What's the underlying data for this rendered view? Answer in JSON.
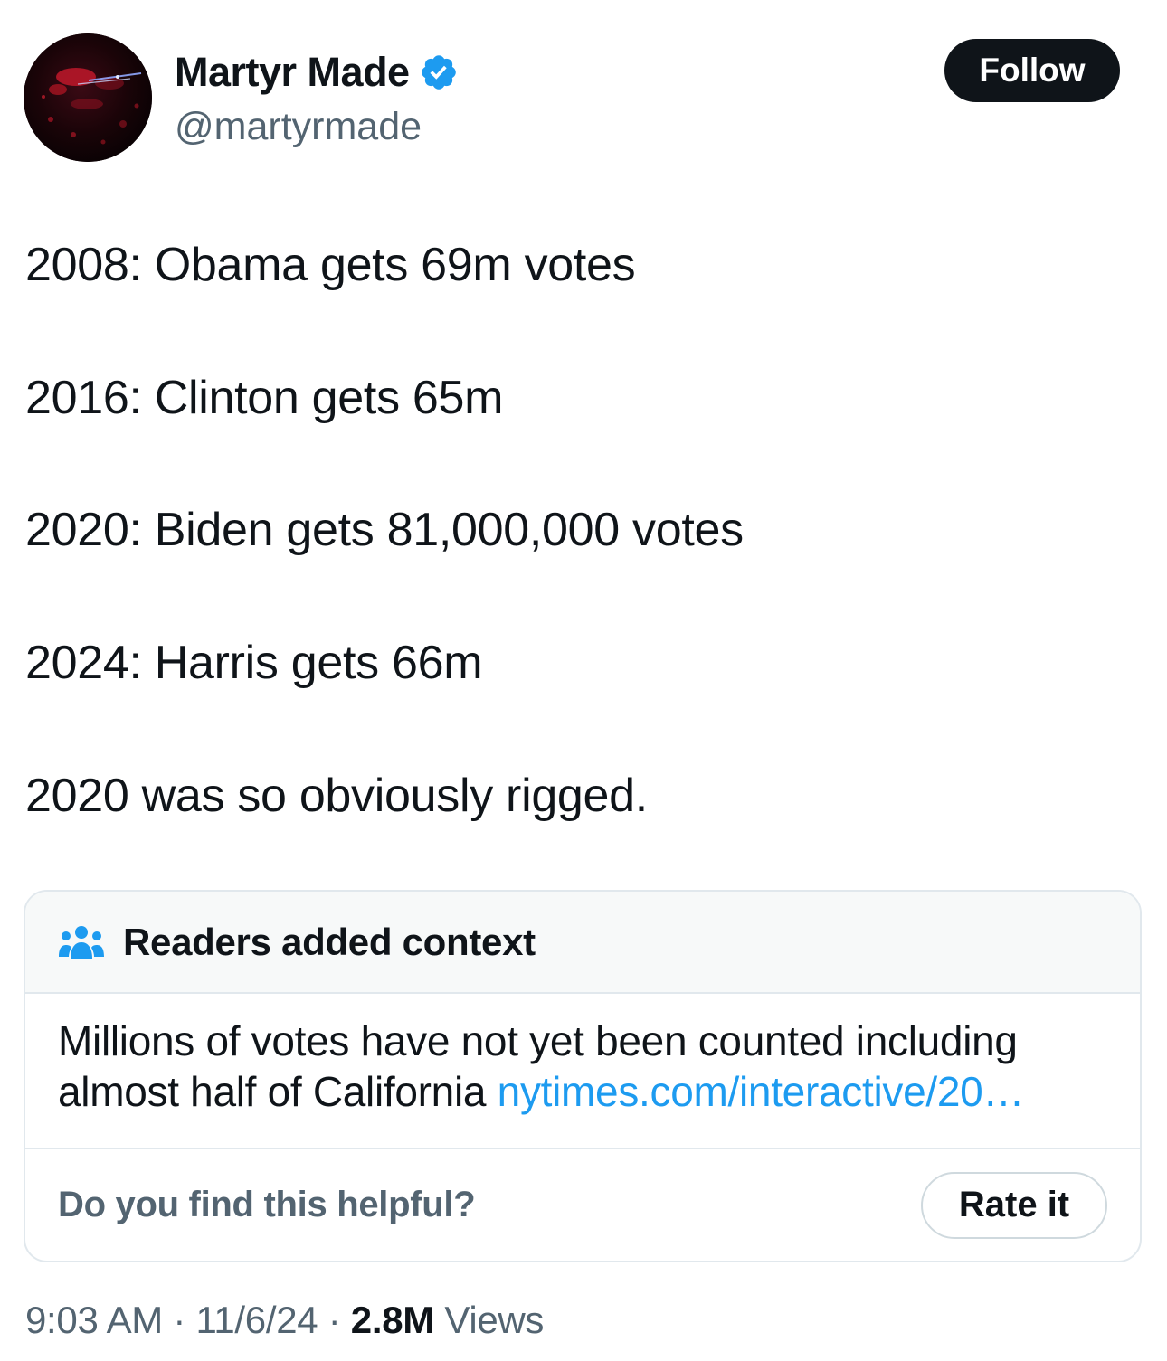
{
  "author": {
    "display_name": "Martyr Made",
    "handle": "@martyrmade",
    "verified": true,
    "verified_color": "#1d9bf0",
    "avatar_icon": "avatar-image"
  },
  "follow_label": "Follow",
  "tweet": {
    "lines": [
      "2008: Obama gets 69m votes",
      "2016: Clinton gets 65m",
      "2020: Biden gets 81,000,000 votes",
      "2024: Harris gets 66m",
      "2020 was so obviously rigged."
    ]
  },
  "community_note": {
    "icon": "people-icon",
    "title": "Readers added context",
    "text": "Millions of votes have not yet been counted including almost half of California",
    "link_text": "nytimes.com/interactive/20…",
    "link_color": "#1d9bf0",
    "helpful_question": "Do you find this helpful?",
    "rate_label": "Rate it"
  },
  "meta": {
    "time": "9:03 AM",
    "separator": "·",
    "date": "11/6/24",
    "views_count": "2.8M",
    "views_label": "Views"
  }
}
